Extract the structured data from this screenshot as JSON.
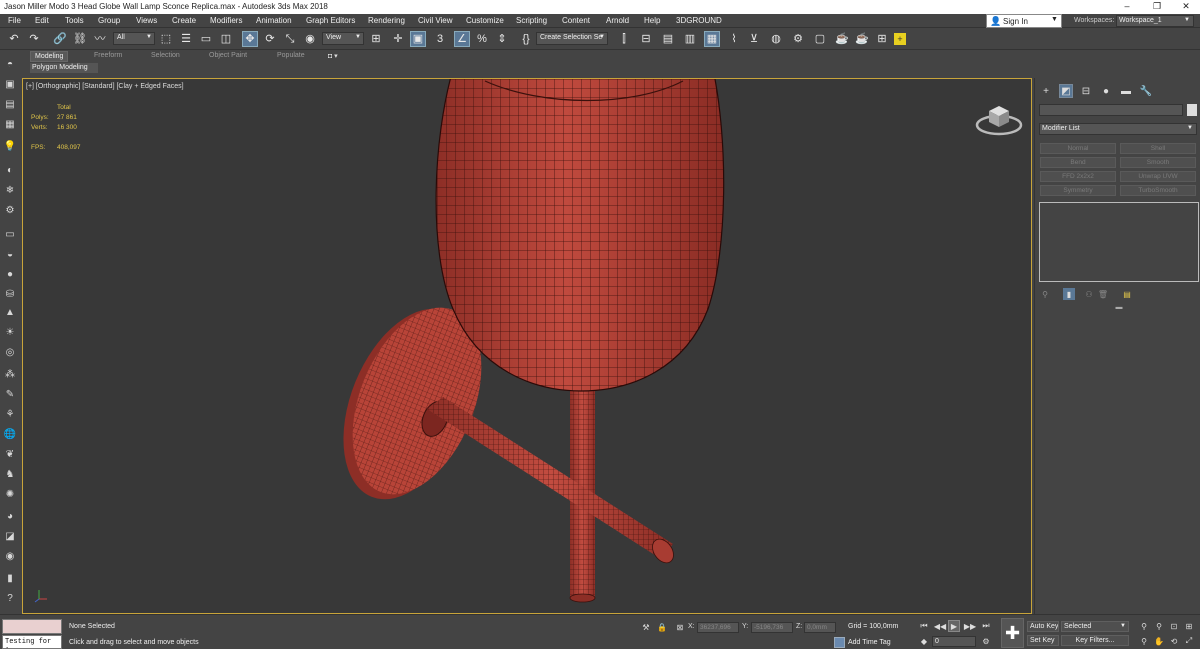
{
  "window": {
    "title": "Jason Miller Modo 3 Head Globe Wall Lamp Sconce Replica.max - Autodesk 3ds Max 2018",
    "minimize": "–",
    "maximize": "❐",
    "close": "✕"
  },
  "menu": [
    "File",
    "Edit",
    "Tools",
    "Group",
    "Views",
    "Create",
    "Modifiers",
    "Animation",
    "Graph Editors",
    "Rendering",
    "Civil View",
    "Customize",
    "Scripting",
    "Content",
    "Arnold",
    "Help",
    "3DGROUND"
  ],
  "account": {
    "sign_in": "Sign In",
    "workspaces_label": "Workspaces:",
    "workspace": "Workspace_1"
  },
  "toolbar": {
    "selection_filter": "All",
    "ref_coord": "View",
    "selection_set": "Create Selection Se"
  },
  "ribbon": {
    "tabs": [
      "Modeling",
      "Freeform",
      "Selection",
      "Object Paint",
      "Populate"
    ],
    "active_tab": "Modeling",
    "subtitle": "Polygon Modeling"
  },
  "viewport": {
    "label": "[+] [Orthographic] [Standard] [Clay + Edged Faces]",
    "stats": {
      "header": "Total",
      "polys_label": "Polys:",
      "polys": "27 861",
      "verts_label": "Verts:",
      "verts": "16 300",
      "fps_label": "FPS:",
      "fps": "408,097"
    }
  },
  "command_panel": {
    "modifier_list": "Modifier List",
    "modifier_buttons": [
      "Normal",
      "Shell",
      "Bend",
      "Smooth",
      "FFD 2x2x2",
      "Unwrap UVW",
      "Symmetry",
      "TurboSmooth"
    ]
  },
  "status": {
    "script_output": "Testing for :",
    "selection": "None Selected",
    "hint": "Click and drag to select and move objects",
    "x_label": "X:",
    "x_value": "36237,696",
    "y_label": "Y:",
    "y_value": "-5196,736",
    "z_label": "Z:",
    "z_value": "0,0mm",
    "grid": "Grid = 100,0mm",
    "add_time_tag": "Add Time Tag",
    "frame": "0",
    "auto_key": "Auto Key",
    "set_key": "Set Key",
    "selected": "Selected",
    "key_filters": "Key Filters..."
  },
  "colors": {
    "model_red": "#b5443a",
    "viewport_border": "#c8a43a",
    "stats_text": "#e2c64a",
    "active_tool": "#5a7896"
  }
}
